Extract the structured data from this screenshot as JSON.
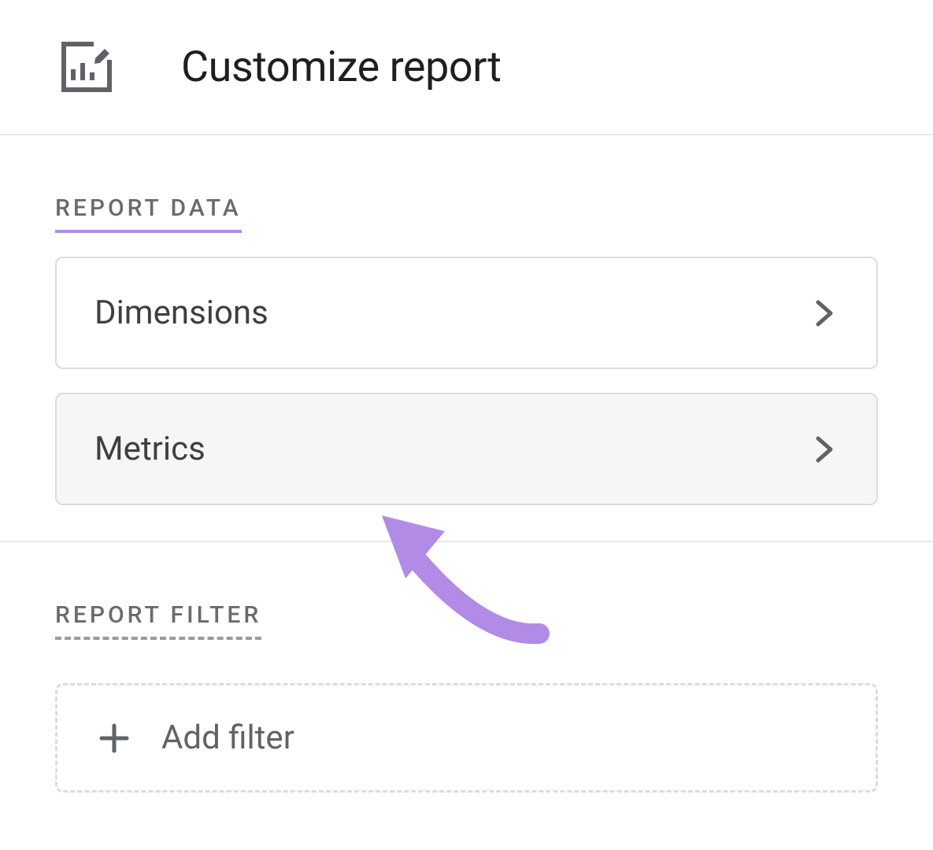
{
  "header": {
    "title": "Customize report"
  },
  "sections": {
    "report_data": {
      "heading": "REPORT DATA",
      "options": {
        "dimensions": "Dimensions",
        "metrics": "Metrics"
      }
    },
    "report_filter": {
      "heading": "REPORT FILTER",
      "add_filter_label": "Add filter"
    }
  }
}
